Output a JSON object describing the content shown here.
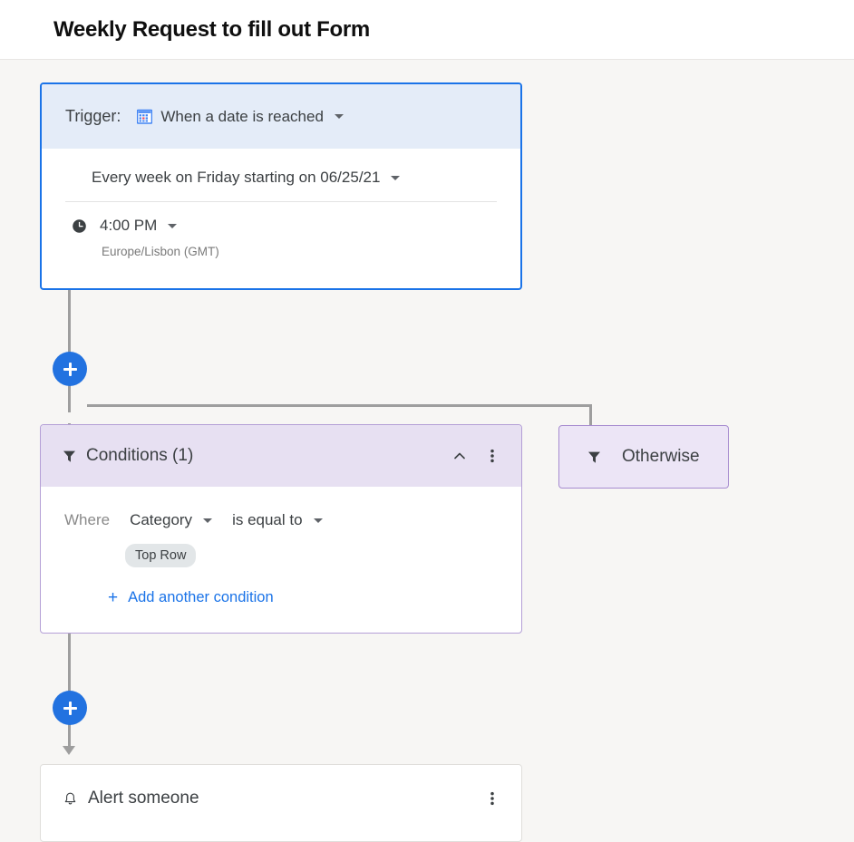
{
  "header": {
    "title": "Weekly Request to fill out Form"
  },
  "trigger": {
    "label": "Trigger:",
    "icon": "calendar-icon",
    "type_value": "When a date is reached",
    "recurrence": "Every week on Friday starting on 06/25/21",
    "time_icon": "clock-icon",
    "time_value": "4:00 PM",
    "timezone": "Europe/Lisbon (GMT)"
  },
  "conditions": {
    "icon": "filter-icon",
    "title": "Conditions (1)",
    "collapse_icon": "chevron-up-icon",
    "menu_icon": "kebab-menu-icon",
    "where_label": "Where",
    "field": "Category",
    "operator": "is equal to",
    "value_chip": "Top Row",
    "add_label": "Add another condition",
    "add_plus": "+"
  },
  "otherwise": {
    "icon": "filter-icon",
    "label": "Otherwise"
  },
  "action": {
    "icon": "bell-icon",
    "title": "Alert someone",
    "menu_icon": "kebab-menu-icon"
  },
  "connectors": {
    "add_step_button_1": "+",
    "add_step_button_2": "+"
  },
  "colors": {
    "accent_blue": "#2272e0",
    "trigger_border": "#1a73e8",
    "trigger_header_bg": "#e4ecf8",
    "condition_border": "#b49fd6",
    "condition_header_bg": "#e7e0f2",
    "otherwise_bg": "#ece5f6",
    "canvas_bg": "#f7f6f4",
    "connector_grey": "#9e9e9e"
  }
}
